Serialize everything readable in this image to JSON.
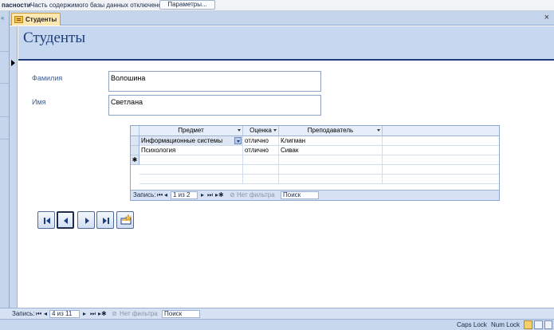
{
  "message_bar": {
    "security_label": "пасности",
    "text": "Часть содержимого базы данных отключено",
    "options_button": "Параметры..."
  },
  "tab": {
    "label": "Студенты"
  },
  "form": {
    "title": "Студенты",
    "fields": {
      "surname_label": "Фамилия",
      "surname_value": "Волошина",
      "name_label": "Имя",
      "name_value": "Светлана"
    }
  },
  "subform": {
    "columns": [
      "Предмет",
      "Оценка",
      "Преподаватель"
    ],
    "rows": [
      [
        "Информационные системы",
        "отлично",
        "Клигман"
      ],
      [
        "Психология",
        "отлично",
        "Сивак"
      ]
    ],
    "new_row_marker": "✱",
    "nav": {
      "record_label": "Запись:",
      "record_value": "1 из 2",
      "filter_label": "Нет фильтра",
      "search_label": "Поиск"
    }
  },
  "form_nav": {
    "record_label": "Запись:",
    "record_value": "4 из 11",
    "filter_label": "Нет фильтра",
    "search_label": "Поиск"
  },
  "app_status": {
    "caps_lock": "Caps Lock",
    "num_lock": "Num Lock"
  },
  "colors": {
    "header_bg": "#c6d8f0",
    "title_color": "#1f3d7a",
    "label_color": "#3b5f98"
  }
}
